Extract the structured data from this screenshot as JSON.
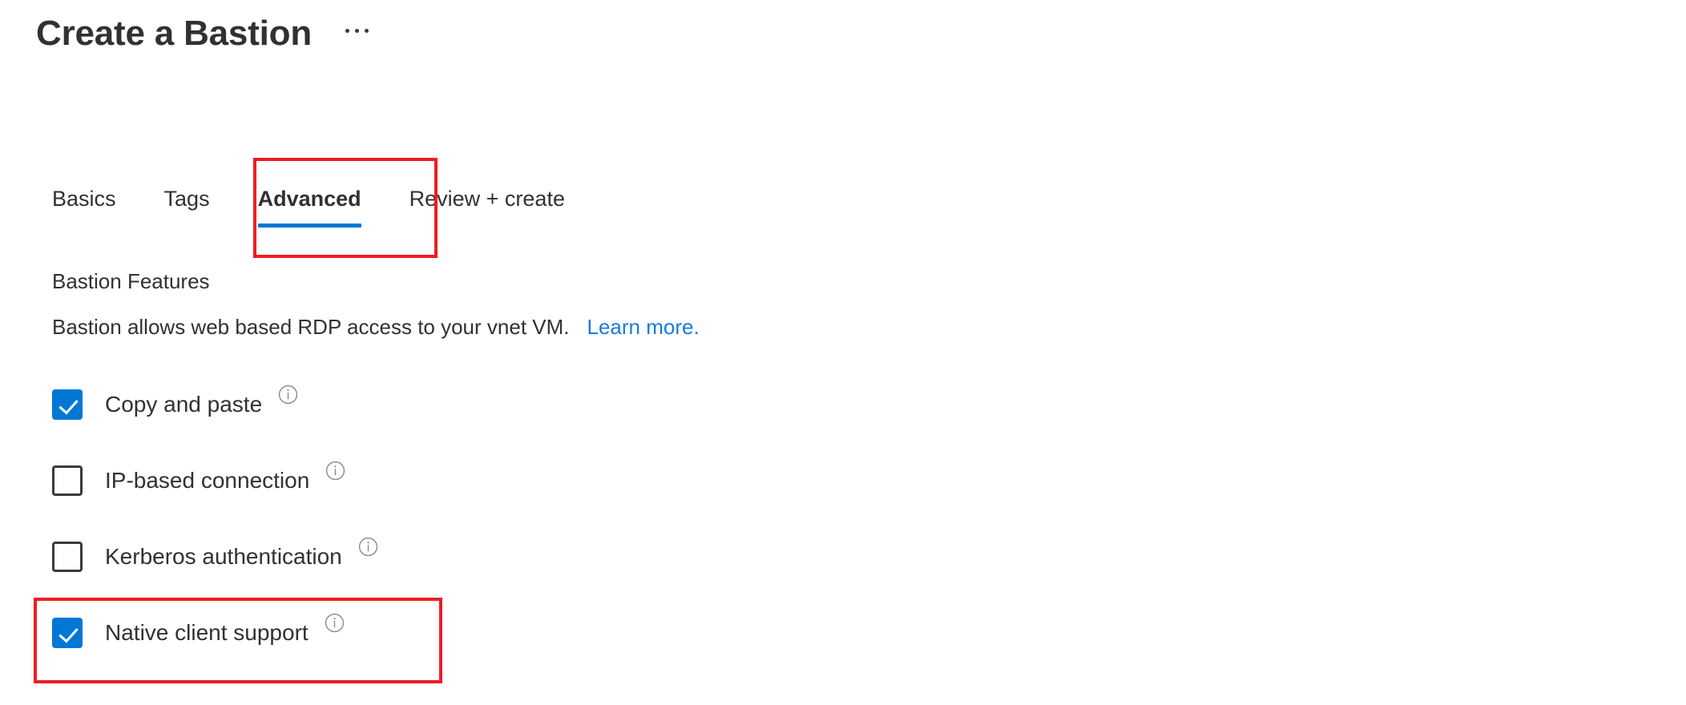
{
  "header": {
    "title": "Create a Bastion",
    "more_menu_label": "..."
  },
  "tabs": [
    {
      "label": "Basics",
      "active": false
    },
    {
      "label": "Tags",
      "active": false
    },
    {
      "label": "Advanced",
      "active": true
    },
    {
      "label": "Review + create",
      "active": false
    }
  ],
  "section": {
    "heading": "Bastion Features",
    "description": "Bastion allows web based RDP access to your vnet VM.",
    "learn_more": "Learn more."
  },
  "features": [
    {
      "label": "Copy and paste",
      "checked": true,
      "info": "i"
    },
    {
      "label": "IP-based connection",
      "checked": false,
      "info": "i"
    },
    {
      "label": "Kerberos authentication",
      "checked": false,
      "info": "i"
    },
    {
      "label": "Native client support",
      "checked": true,
      "info": "i"
    }
  ],
  "annotations": [
    {
      "target": "Advanced tab"
    },
    {
      "target": "Native client support checkbox"
    }
  ],
  "colors": {
    "accent_blue": "#0078d4",
    "link_blue": "#1a7ae0",
    "annotation_red": "#ee1c25",
    "text": "#323130"
  }
}
